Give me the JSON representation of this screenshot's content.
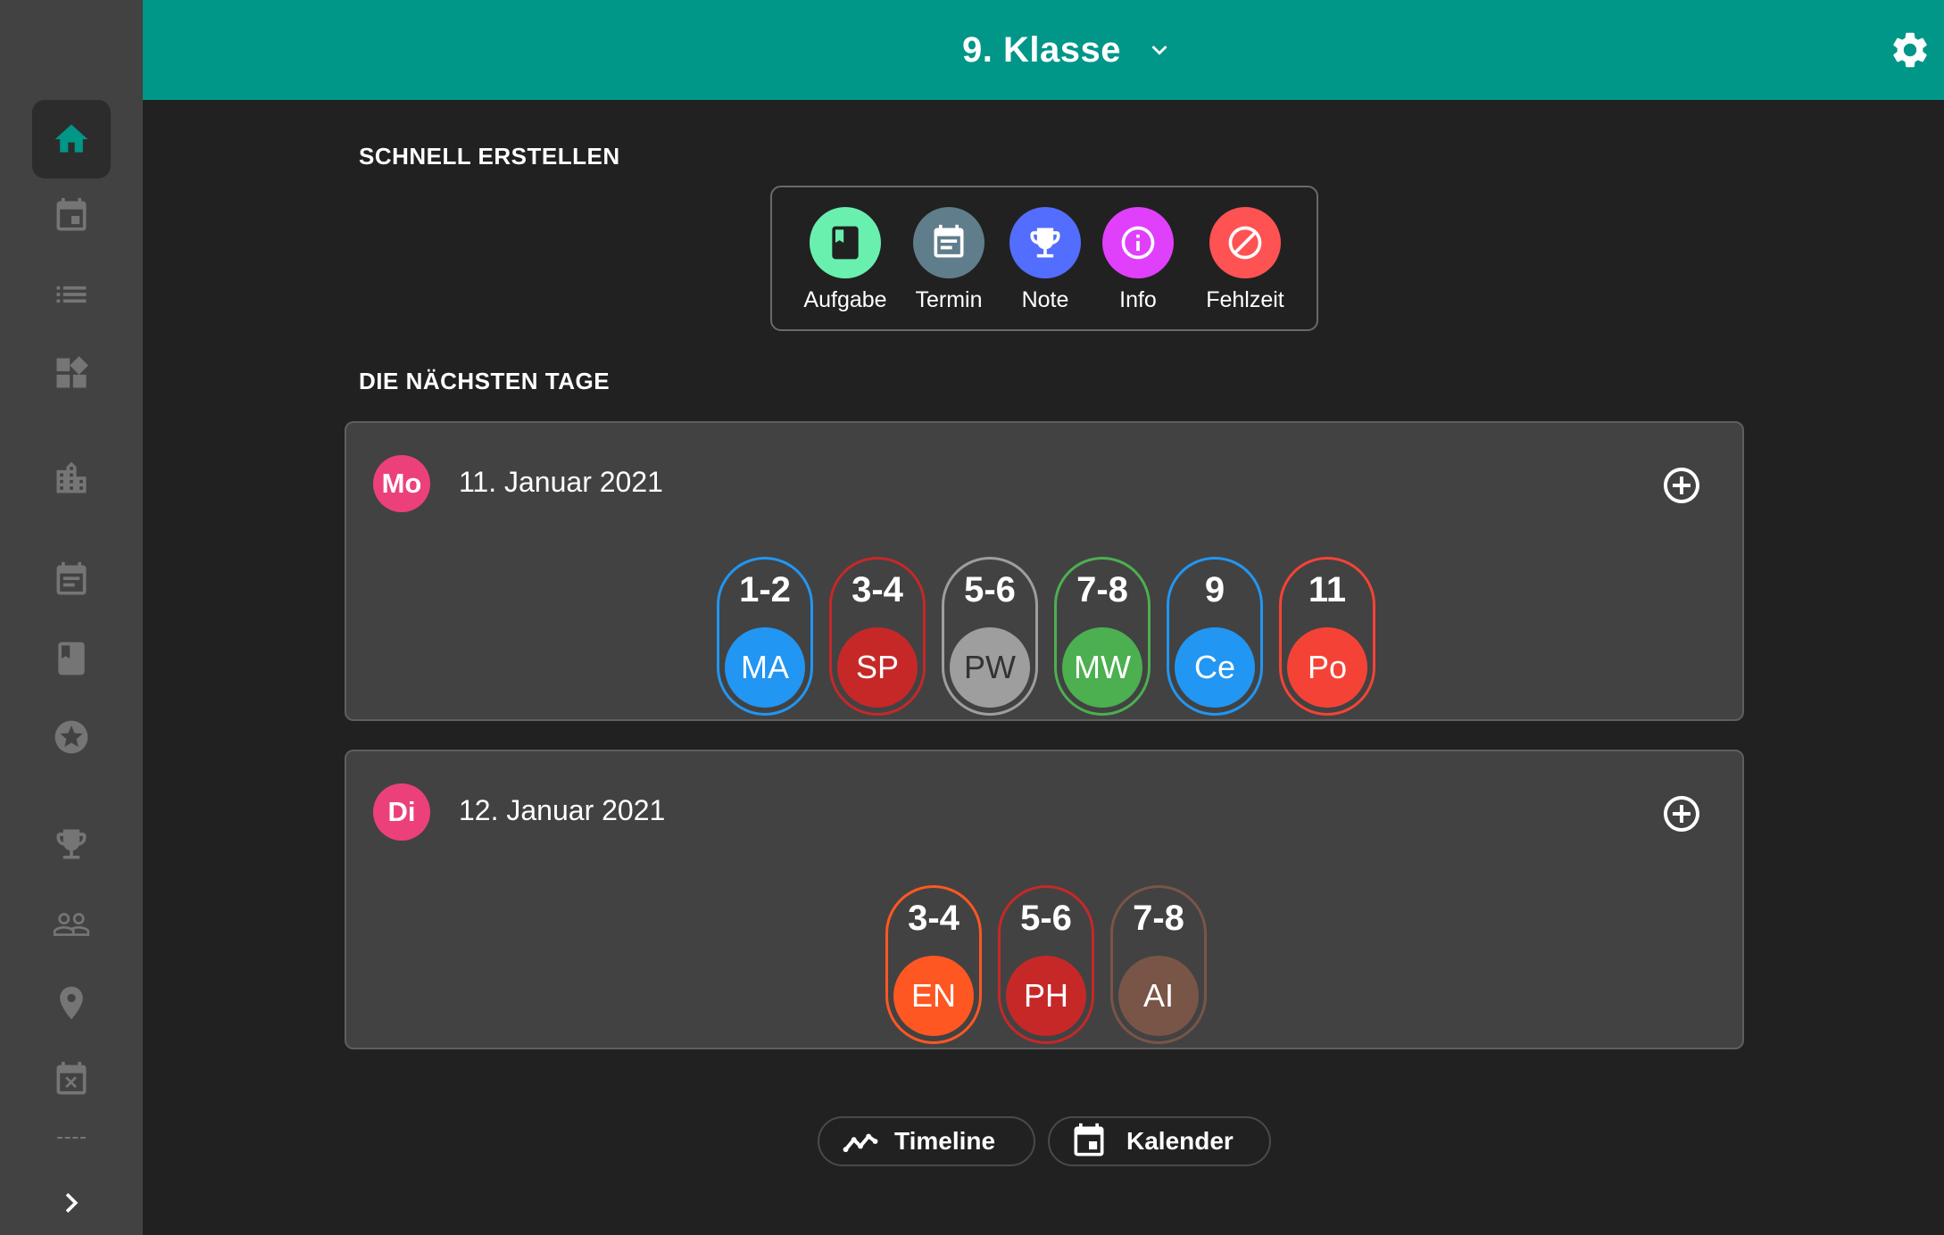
{
  "header": {
    "class_label": "9. Klasse"
  },
  "sidebar": {
    "items": [
      {
        "icon": "home-icon",
        "active": true
      },
      {
        "icon": "calendar-event-icon"
      },
      {
        "icon": "list-icon"
      },
      {
        "icon": "widgets-icon"
      },
      {
        "icon": "building-icon"
      },
      {
        "icon": "event-note-icon"
      },
      {
        "icon": "book-icon"
      },
      {
        "icon": "star-icon"
      },
      {
        "icon": "trophy-icon"
      },
      {
        "icon": "people-icon"
      },
      {
        "icon": "location-icon"
      },
      {
        "icon": "calendar-x-icon"
      },
      {
        "icon": "chevron-right-icon"
      }
    ]
  },
  "quick_create": {
    "heading": "SCHNELL ERSTELLEN",
    "items": [
      {
        "label": "Aufgabe",
        "color": "#69f0ae",
        "icon": "book-icon"
      },
      {
        "label": "Termin",
        "color": "#607d8b",
        "icon": "event-note-icon"
      },
      {
        "label": "Note",
        "color": "#536dfe",
        "icon": "trophy-icon"
      },
      {
        "label": "Info",
        "color": "#e040fb",
        "icon": "info-icon"
      },
      {
        "label": "Fehlzeit",
        "color": "#ff5252",
        "icon": "block-icon"
      }
    ]
  },
  "upcoming": {
    "heading": "DIE NÄCHSTEN TAGE",
    "days": [
      {
        "badge": "Mo",
        "date": "11. Januar 2021",
        "lessons": [
          {
            "period": "1-2",
            "subject": "MA",
            "color": "#2196f3"
          },
          {
            "period": "3-4",
            "subject": "SP",
            "color": "#c62828"
          },
          {
            "period": "5-6",
            "subject": "PW",
            "color": "#9e9e9e"
          },
          {
            "period": "7-8",
            "subject": "MW",
            "color": "#4caf50"
          },
          {
            "period": "9",
            "subject": "Ce",
            "color": "#2196f3"
          },
          {
            "period": "11",
            "subject": "Po",
            "color": "#f44336"
          }
        ]
      },
      {
        "badge": "Di",
        "date": "12. Januar 2021",
        "lessons": [
          {
            "period": "3-4",
            "subject": "EN",
            "color": "#ff5722"
          },
          {
            "period": "5-6",
            "subject": "PH",
            "color": "#c62828"
          },
          {
            "period": "7-8",
            "subject": "AI",
            "color": "#795548"
          }
        ]
      }
    ]
  },
  "bottom_buttons": {
    "timeline_label": "Timeline",
    "calendar_label": "Kalender"
  }
}
